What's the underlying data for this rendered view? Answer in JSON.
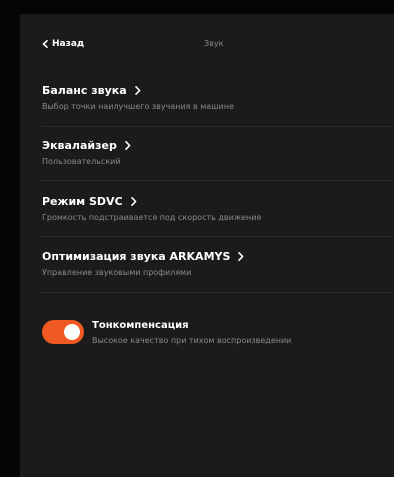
{
  "header": {
    "back_label": "Назад",
    "title": "Звук"
  },
  "items": [
    {
      "title": "Баланс звука",
      "subtitle": "Выбор точки наилучшего звучания в машине"
    },
    {
      "title": "Эквалайзер",
      "subtitle": "Пользовательский"
    },
    {
      "title": "Режим SDVC",
      "subtitle": "Громкость подстраивается под скорость движения"
    },
    {
      "title": "Оптимизация звука ARKAMYS",
      "subtitle": "Управление звуковыми профилями"
    }
  ],
  "loudness": {
    "title": "Тонкомпенсация",
    "subtitle": "Высокое качество при тихом воспроизведении",
    "enabled": true,
    "accent": "#f05a22"
  },
  "colors": {
    "background": "#050505",
    "panel": "#1b1b1b",
    "secondary_text": "#8a8a8a",
    "divider": "#2c2c2c"
  },
  "icons": {
    "back": "chevron-left-icon",
    "item": "chevron-right-icon"
  }
}
